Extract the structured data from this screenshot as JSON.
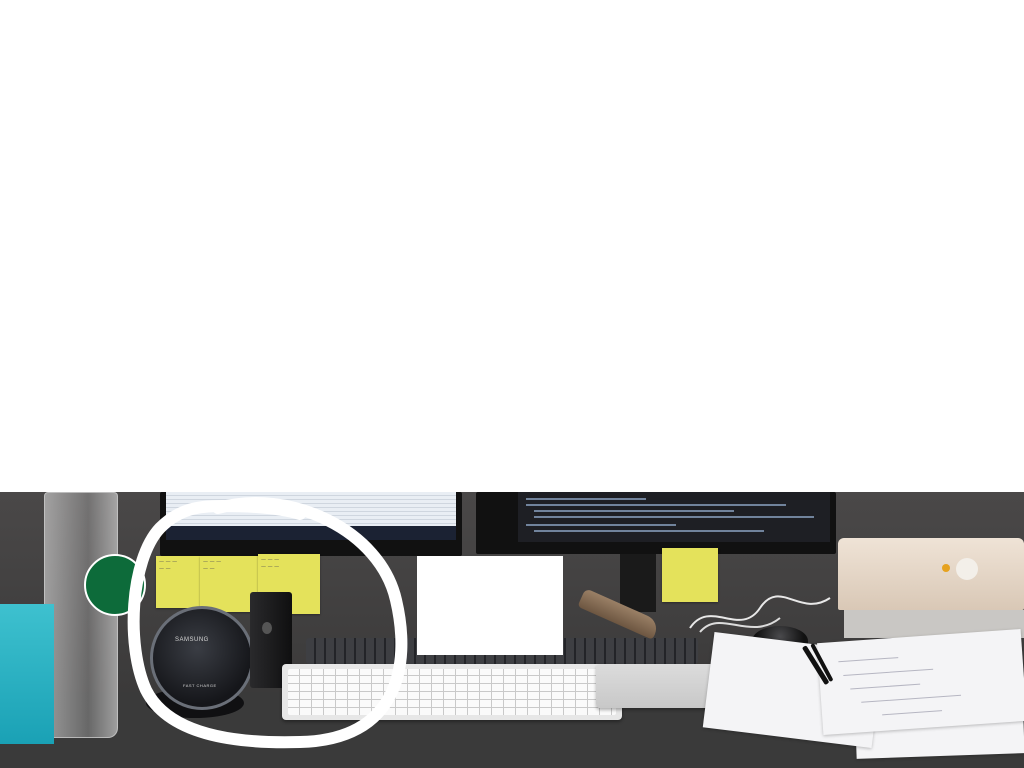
{
  "scene": {
    "description_free": true,
    "charger": {
      "brand_text": "SAMSUNG",
      "label_text": "FAST CHARGE"
    }
  },
  "colors": {
    "page_background": "#ffffff",
    "desk": "#c07f3c",
    "sticky_note": "#e4e25b",
    "annotation_stroke": "#ffffff",
    "redaction_box": "#ffffff",
    "tissue_box": "#2fb4c4",
    "starbucks_green": "#0d6b3a"
  },
  "annotations": [
    {
      "type": "freehand-circle",
      "color": "#ffffff",
      "target": "wireless-charger-and-battery"
    },
    {
      "type": "filled-rectangle",
      "color": "#ffffff",
      "target": "redacted-object"
    }
  ]
}
